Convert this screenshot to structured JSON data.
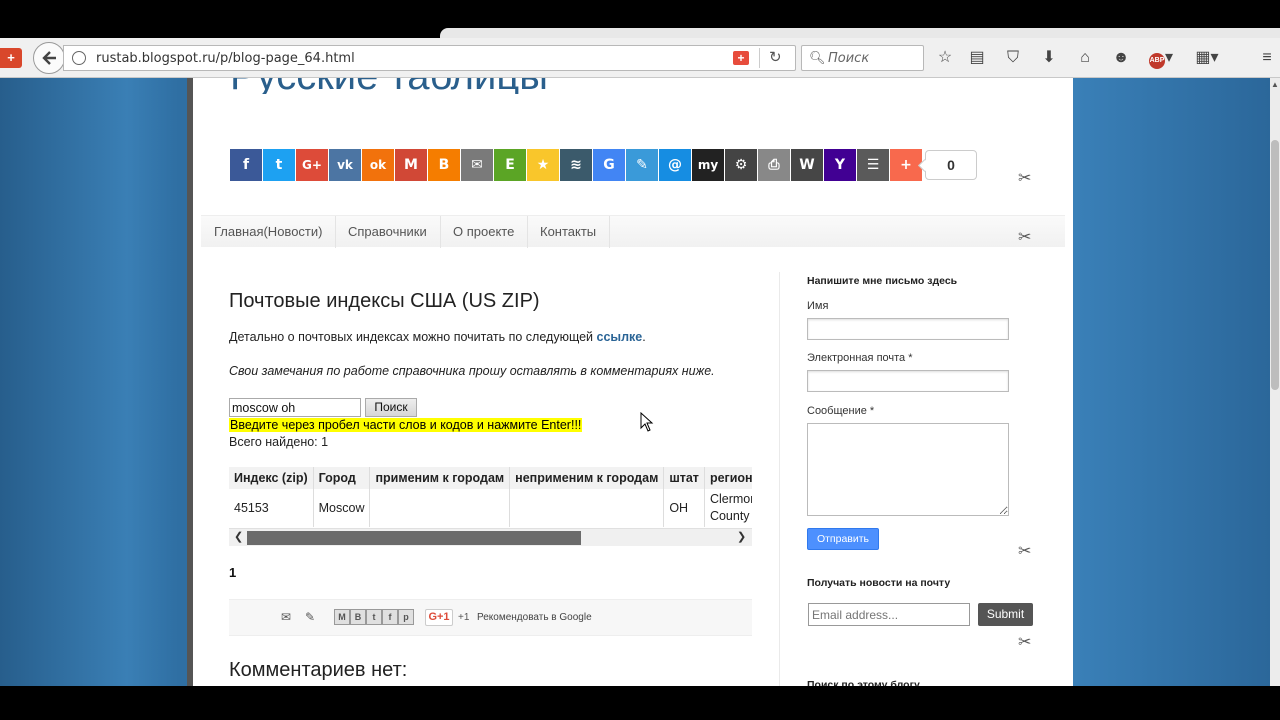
{
  "browser": {
    "url": "rustab.blogspot.ru/p/blog-page_64.html",
    "search_placeholder": "Поиск",
    "abp": "ABP"
  },
  "blog": {
    "title": "Русские таблицы"
  },
  "share": {
    "count": "0",
    "buttons": [
      {
        "name": "facebook",
        "glyph": "f",
        "color": "#3b5998"
      },
      {
        "name": "twitter",
        "glyph": "t",
        "color": "#1da1f2"
      },
      {
        "name": "google-plus",
        "glyph": "G+",
        "color": "#dd4b39"
      },
      {
        "name": "vkontakte",
        "glyph": "vk",
        "color": "#4c75a3"
      },
      {
        "name": "odnoklassniki",
        "glyph": "ok",
        "color": "#f2720c"
      },
      {
        "name": "gmail",
        "glyph": "M",
        "color": "#d14836"
      },
      {
        "name": "blogger",
        "glyph": "B",
        "color": "#f57d00"
      },
      {
        "name": "email",
        "glyph": "✉",
        "color": "#7a7a7a"
      },
      {
        "name": "evernote",
        "glyph": "E",
        "color": "#5ba525"
      },
      {
        "name": "favorites",
        "glyph": "★",
        "color": "#f9c62b"
      },
      {
        "name": "delicious",
        "glyph": "≋",
        "color": "#3b5a6b"
      },
      {
        "name": "google-bookmarks",
        "glyph": "G",
        "color": "#4285f4"
      },
      {
        "name": "instapaper",
        "glyph": "✎",
        "color": "#3a9ad9"
      },
      {
        "name": "mail-ru",
        "glyph": "@",
        "color": "#168de2"
      },
      {
        "name": "myworld",
        "glyph": "my",
        "color": "#222"
      },
      {
        "name": "settings",
        "glyph": "⚙",
        "color": "#444"
      },
      {
        "name": "print",
        "glyph": "⎙",
        "color": "#888"
      },
      {
        "name": "wordpress",
        "glyph": "W",
        "color": "#464646"
      },
      {
        "name": "yahoo",
        "glyph": "Y",
        "color": "#410093"
      },
      {
        "name": "readability",
        "glyph": "☰",
        "color": "#5a5a5a"
      },
      {
        "name": "addthis",
        "glyph": "+",
        "color": "#f8694d"
      }
    ]
  },
  "nav": {
    "items": [
      "Главная(Новости)",
      "Справочники",
      "О проекте",
      "Контакты"
    ]
  },
  "post": {
    "title": "Почтовые индексы США (US ZIP)",
    "intro_text": "Детально о почтовых индексах можно почитать по следующей",
    "intro_link": "ссылке",
    "intro_end": ".",
    "note": "Свои замечания по работе справочника прошу оставлять в комментариях ниже.",
    "search_value": "moscow oh",
    "search_button": "Поиск",
    "hint": "Введите через пробел части слов и кодов и нажмите Enter!!!",
    "found": "Всего найдено: 1",
    "table": {
      "headers": [
        "Индекс (zip)",
        "Город",
        "применим к городам",
        "неприменим к городам",
        "штат",
        "регион"
      ],
      "rows": [
        [
          "45153",
          "Moscow",
          "",
          "",
          "OH",
          "Clermont County"
        ]
      ]
    },
    "pager": "1",
    "gplus_label": "G+1",
    "gplus_count": "+1",
    "recommend": "Рекомендовать в Google",
    "comments": "Комментариев нет:"
  },
  "sidebar": {
    "contact_title": "Напишите мне письмо здесь",
    "name_label": "Имя",
    "email_label": "Электронная почта *",
    "message_label": "Сообщение *",
    "send_button": "Отправить",
    "subscribe_title": "Получать новости на почту",
    "subscribe_placeholder": "Email address...",
    "subscribe_button": "Submit",
    "search_title": "Поиск по этому блогу"
  }
}
